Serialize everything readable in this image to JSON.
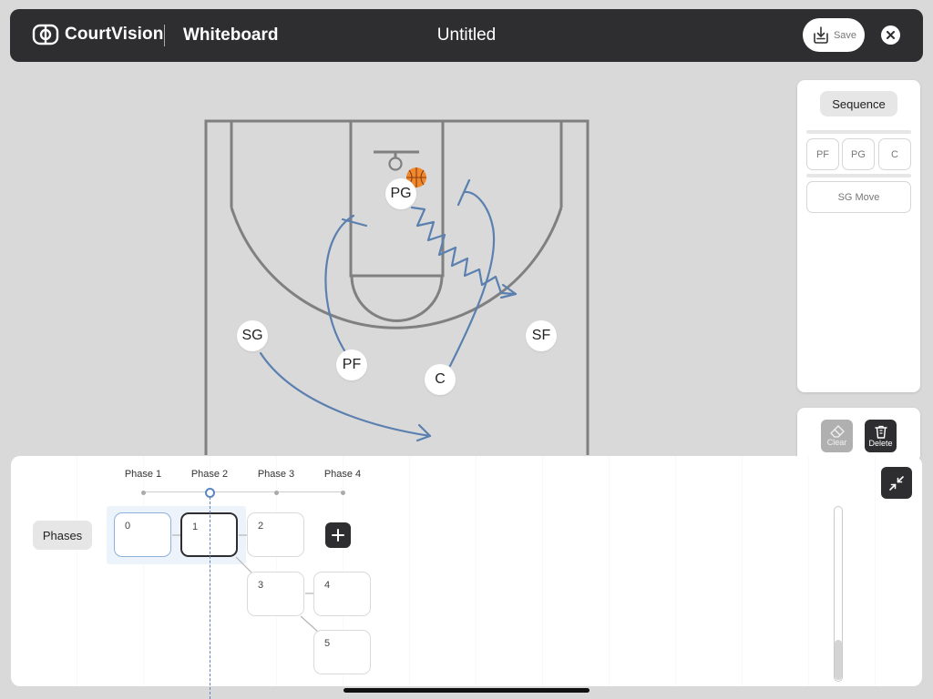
{
  "header": {
    "brand": "CourtVision",
    "section": "Whiteboard",
    "doc_title": "Untitled",
    "save_label": "Save",
    "icons": {
      "logo": "court-logo-icon",
      "save": "download-tray-icon",
      "close": "close-icon"
    }
  },
  "court": {
    "players": [
      {
        "label": "PG"
      },
      {
        "label": "SG"
      },
      {
        "label": "PF"
      },
      {
        "label": "C"
      },
      {
        "label": "SF"
      }
    ],
    "ball_icon": "basketball-icon",
    "line_color": "#808080",
    "play_color": "#5b80b0"
  },
  "sequence": {
    "title": "Sequence",
    "chips": [
      "PF",
      "PG",
      "C"
    ],
    "move_label": "SG Move"
  },
  "tools": {
    "clear_label": "Clear",
    "delete_label": "Delete",
    "icons": {
      "clear": "eraser-icon",
      "delete": "trash-icon"
    }
  },
  "timeline": {
    "phases": [
      "Phase 1",
      "Phase 2",
      "Phase 3",
      "Phase 4"
    ],
    "current_phase": "Phase 2",
    "phases_button": "Phases",
    "frames": [
      "0",
      "1",
      "2",
      "3",
      "4",
      "5"
    ],
    "selected_frame": "1",
    "icons": {
      "add": "plus-icon",
      "collapse": "collapse-arrows-icon"
    }
  },
  "colors": {
    "header_bg": "#2e2e30",
    "accent": "#5b87c0",
    "background": "#d9d9d9"
  }
}
